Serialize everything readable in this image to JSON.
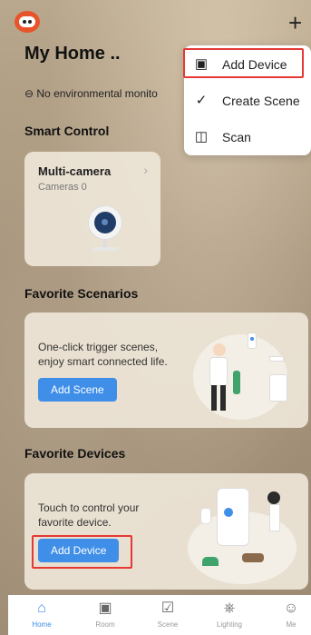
{
  "header": {
    "title": "My Home ..",
    "env_text": "⊖ No environmental monito",
    "add_icon": "plus-icon"
  },
  "sections": {
    "smart_control": "Smart Control",
    "favorite_scenarios": "Favorite Scenarios",
    "favorite_devices": "Favorite Devices"
  },
  "camera_card": {
    "name": "Multi-camera",
    "sub": "Cameras 0",
    "chevron": "›"
  },
  "scenarios_card": {
    "line1": "One-click trigger scenes,",
    "line2": "enjoy smart connected life.",
    "button": "Add Scene"
  },
  "devices_card": {
    "line1": "Touch to control your",
    "line2": "favorite device.",
    "button": "Add Device"
  },
  "dropdown": {
    "items": [
      {
        "label": "Add Device",
        "icon": "add-device-icon"
      },
      {
        "label": "Create Scene",
        "icon": "create-scene-icon"
      },
      {
        "label": "Scan",
        "icon": "scan-icon"
      }
    ]
  },
  "tabbar": {
    "items": [
      {
        "label": "Home",
        "icon": "home-icon",
        "active": true
      },
      {
        "label": "Room",
        "icon": "room-icon"
      },
      {
        "label": "Scene",
        "icon": "scene-icon"
      },
      {
        "label": "Lighting",
        "icon": "lighting-icon"
      },
      {
        "label": "Me",
        "icon": "me-icon"
      }
    ]
  },
  "colors": {
    "accent": "#3f8ee8",
    "highlight": "#e53935",
    "avatar": "#e8542a"
  }
}
